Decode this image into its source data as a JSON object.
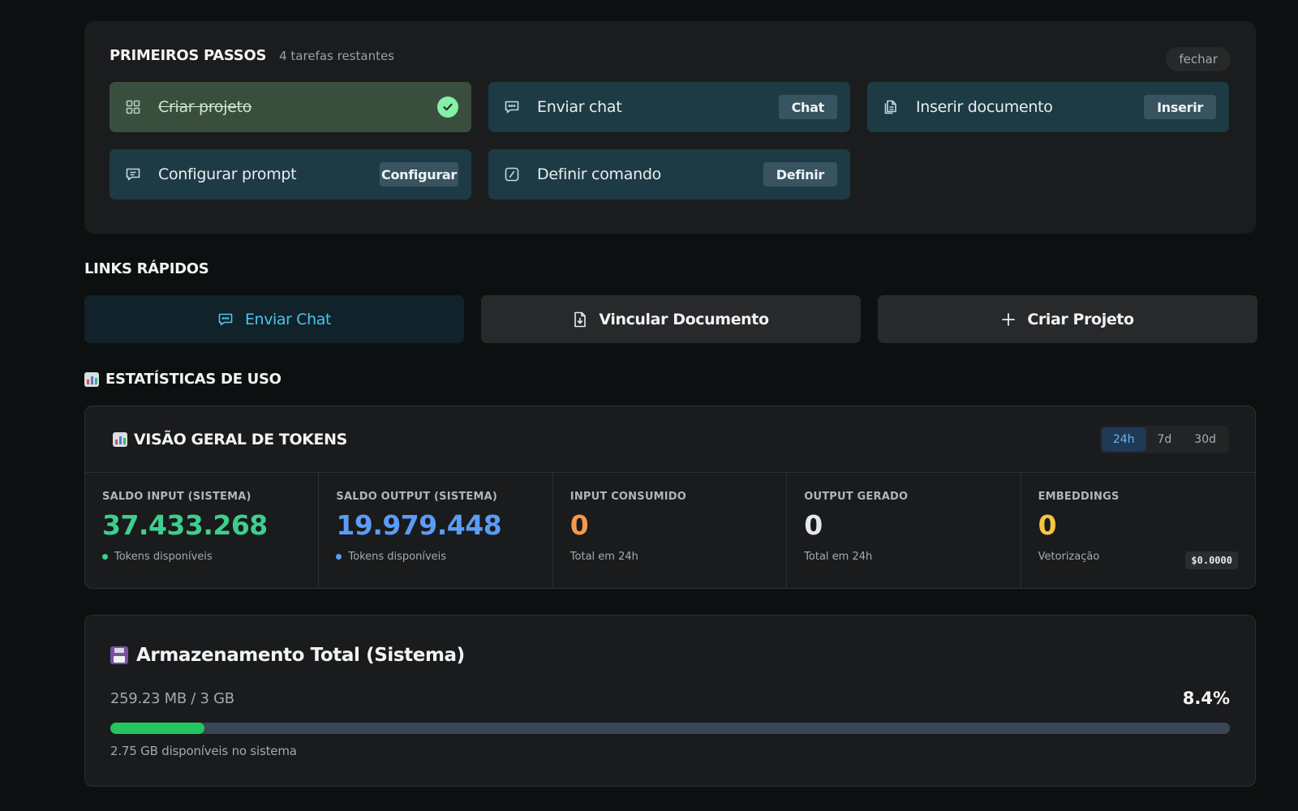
{
  "getting_started": {
    "title": "PRIMEIROS PASSOS",
    "subtitle": "4 tarefas restantes",
    "close_label": "fechar",
    "steps": [
      {
        "label": "Criar projeto",
        "icon": "grid-icon",
        "done": true
      },
      {
        "label": "Enviar chat",
        "icon": "chat-icon",
        "action": "Chat"
      },
      {
        "label": "Inserir documento",
        "icon": "documents-icon",
        "action": "Inserir"
      },
      {
        "label": "Configurar prompt",
        "icon": "message-square-icon",
        "action": "Configurar"
      },
      {
        "label": "Definir comando",
        "icon": "slash-command-icon",
        "action": "Definir"
      }
    ]
  },
  "quick_links": {
    "title": "LINKS RÁPIDOS",
    "items": [
      {
        "label": "Enviar Chat",
        "icon": "chat-icon"
      },
      {
        "label": "Vincular Documento",
        "icon": "file-download-icon"
      },
      {
        "label": "Criar Projeto",
        "icon": "plus-icon"
      }
    ]
  },
  "usage": {
    "title": "ESTATÍSTICAS DE USO",
    "tokens": {
      "title": "VISÃO GERAL DE TOKENS",
      "ranges": [
        "24h",
        "7d",
        "30d"
      ],
      "active_range": "24h",
      "metrics": [
        {
          "label": "SALDO INPUT (SISTEMA)",
          "value": "37.433.268",
          "foot": "Tokens disponíveis",
          "color": "#3ecf8e"
        },
        {
          "label": "SALDO OUTPUT (SISTEMA)",
          "value": "19.979.448",
          "foot": "Tokens disponíveis",
          "color": "#5b9cf5"
        },
        {
          "label": "INPUT CONSUMIDO",
          "value": "0",
          "foot": "Total em 24h",
          "color": "#f59a4a"
        },
        {
          "label": "OUTPUT GERADO",
          "value": "0",
          "foot": "Total em 24h",
          "color": "#e5e7ea"
        },
        {
          "label": "EMBEDDINGS",
          "value": "0",
          "foot": "Vetorização",
          "color": "#f5c542",
          "badge": "$0.0000"
        }
      ]
    }
  },
  "storage": {
    "title": "Armazenamento Total (Sistema)",
    "used": "259.23 MB / 3 GB",
    "percent_label": "8.4%",
    "percent": 8.4,
    "free": "2.75 GB disponíveis no sistema"
  },
  "colors": {
    "accent_green": "#22c55e",
    "check_green": "#86efa8",
    "step_bg": "#1d3b45",
    "step_done_bg": "#3a4e3e",
    "link_primary": "#4fc3e8"
  }
}
